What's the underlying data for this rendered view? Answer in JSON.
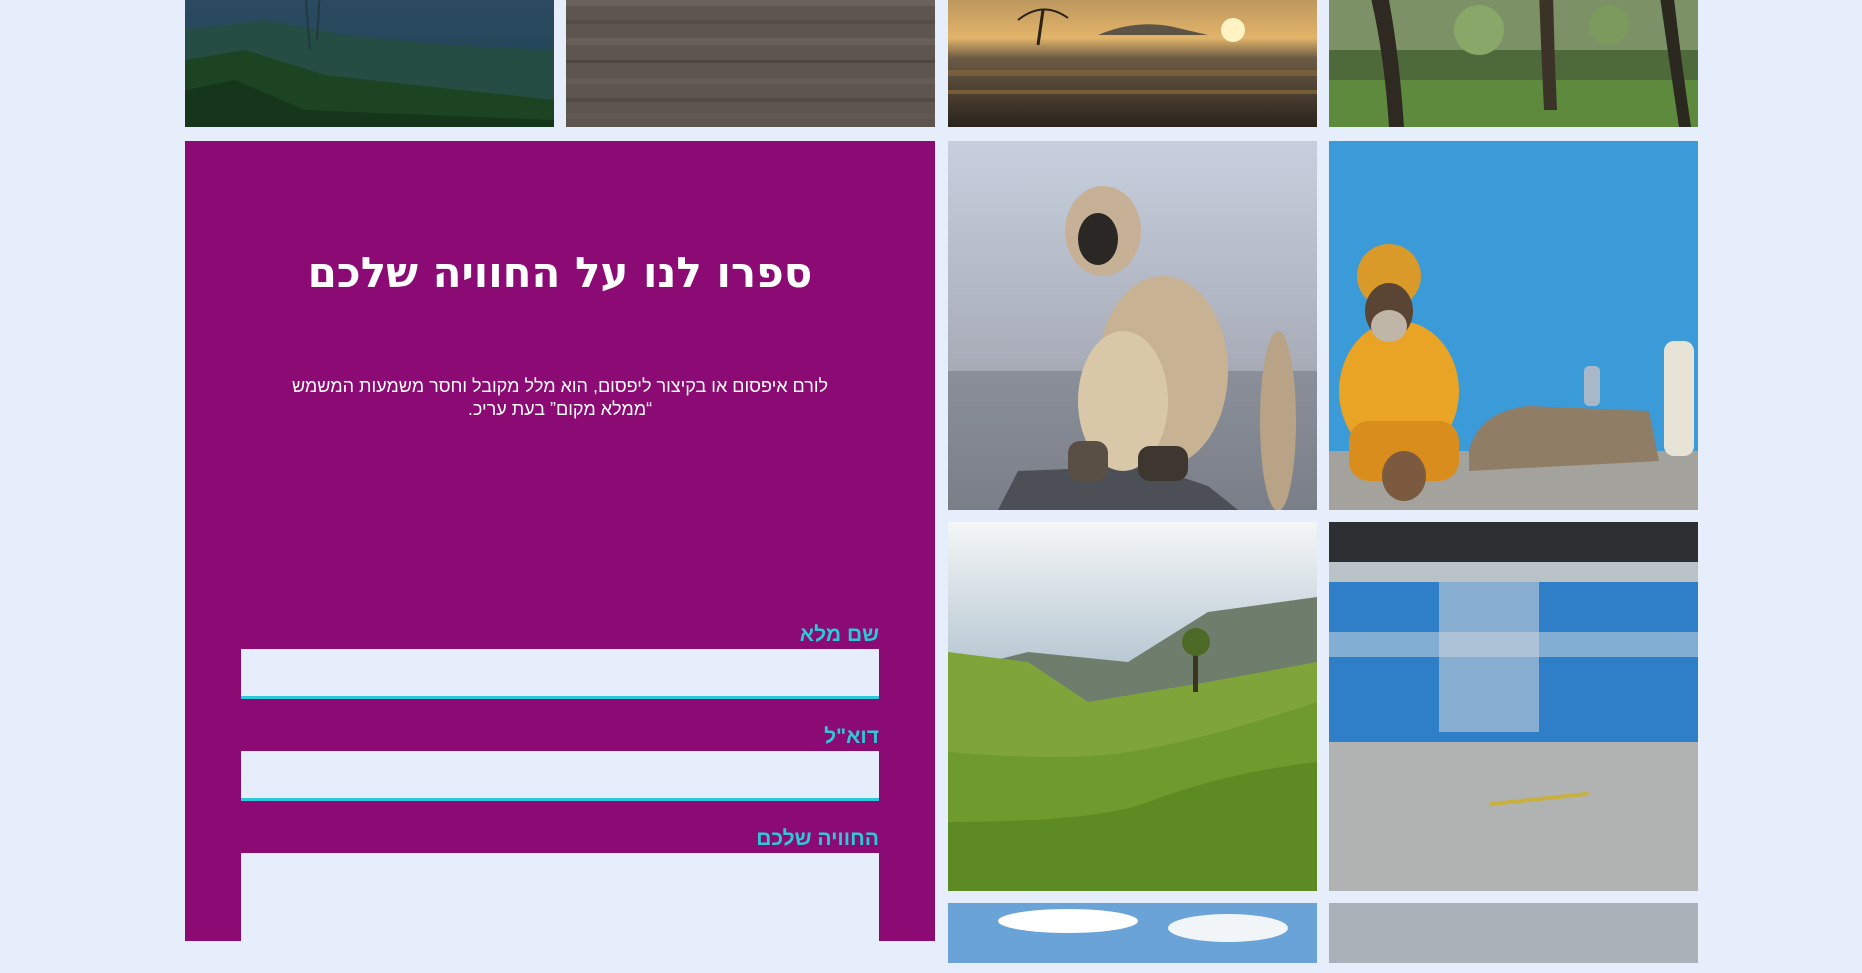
{
  "panel": {
    "title": "ספרו לנו על החוויה שלכם",
    "description": "לורם איפסום או בקיצור ליפסום, הוא מלל מקובל וחסר משמעות המשמש “ממלא מקום” בעת עריכ."
  },
  "form": {
    "name_label": "שם מלא",
    "name_value": "",
    "email_label": "דוא\"ל",
    "email_value": "",
    "experience_label": "החוויה שלכם",
    "experience_value": ""
  },
  "colors": {
    "background": "#e6eefc",
    "panel": "#8b0a73",
    "accent": "#2cc9d9"
  },
  "gallery": {
    "images": [
      "mountain-valley-image",
      "wood-texture-image",
      "sunset-beach-image",
      "palm-forest-image",
      "langur-monkey-image",
      "sadhu-man-image",
      "tea-plantation-image",
      "blue-train-image",
      "sky-clouds-image",
      "grey-sky-image"
    ]
  }
}
